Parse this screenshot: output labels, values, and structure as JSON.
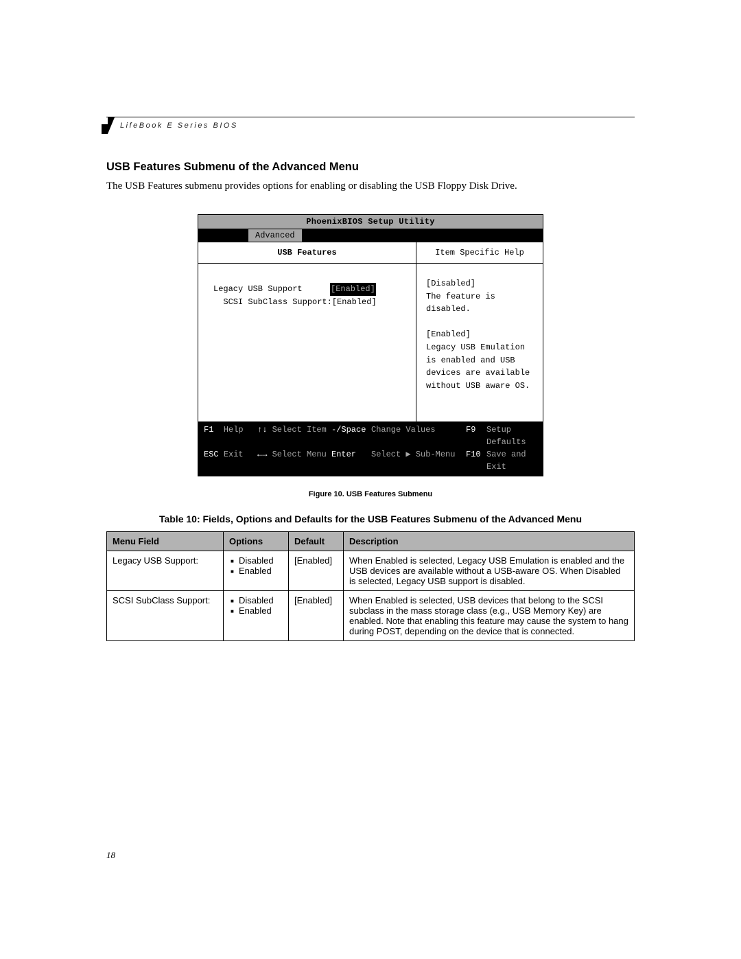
{
  "running_head": "LifeBook E Series BIOS",
  "section_heading": "USB Features Submenu of the Advanced Menu",
  "intro_prose": "The USB Features submenu provides options for enabling or disabling the USB Floppy Disk Drive.",
  "bios": {
    "title": "PhoenixBIOS Setup Utility",
    "menu_tab": "Advanced",
    "submenu_title": "USB Features",
    "help_title": "Item Specific Help",
    "rows": [
      {
        "label": "Legacy USB Support",
        "value": "[Enabled]",
        "selected": true,
        "indent": 0
      },
      {
        "label": "SCSI SubClass Support:",
        "value": "[Enabled]",
        "selected": false,
        "indent": 2
      }
    ],
    "help_lines": [
      "[Disabled]",
      "The feature is disabled.",
      "",
      "[Enabled]",
      "Legacy USB Emulation",
      "is enabled and USB",
      "devices are available",
      "without USB aware OS."
    ],
    "footer": {
      "row1": {
        "k1": "F1",
        "t1": "Help",
        "k2": "↑↓",
        "t2": "Select Item",
        "k3": "-/Space",
        "t3": "Change Values",
        "k4": "F9",
        "t4": "Setup Defaults"
      },
      "row2": {
        "k1": "ESC",
        "t1": "Exit",
        "k2": "←→",
        "t2": "Select Menu",
        "k3": "Enter",
        "t3": "Select ▶ Sub-Menu",
        "k4": "F10",
        "t4": "Save and Exit"
      }
    }
  },
  "figure_caption": "Figure 10.  USB Features Submenu",
  "table_caption": "Table 10: Fields, Options and Defaults for the USB Features Submenu of the Advanced Menu",
  "table": {
    "headers": {
      "c1": "Menu Field",
      "c2": "Options",
      "c3": "Default",
      "c4": "Description"
    },
    "rows": [
      {
        "field": "Legacy USB Support:",
        "options": [
          "Disabled",
          "Enabled"
        ],
        "default": "[Enabled]",
        "desc": "When Enabled is selected, Legacy USB Emulation is enabled and the USB devices are available without a USB-aware OS. When Disabled is selected, Legacy USB support is disabled."
      },
      {
        "field": "SCSI SubClass Support:",
        "options": [
          "Disabled",
          "Enabled"
        ],
        "default": "[Enabled]",
        "desc": "When Enabled is selected, USB devices that belong to the SCSI subclass in the mass storage class (e.g., USB Memory Key) are enabled. Note that enabling this feature may cause the system to hang during POST, depending on the device that is connected."
      }
    ]
  },
  "page_number": "18"
}
